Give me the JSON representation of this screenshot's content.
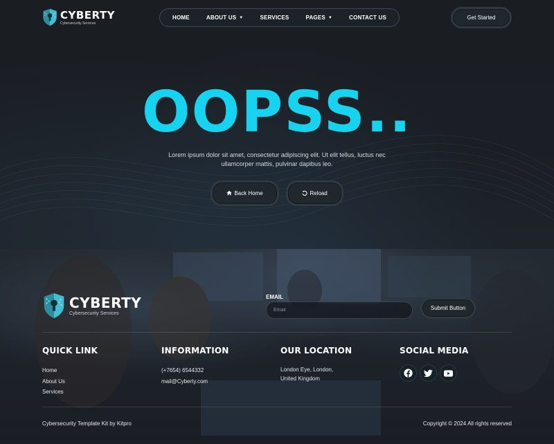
{
  "brand": {
    "name": "CYBERTY",
    "tagline": "Cybersecurity Services",
    "accent_color": "#16d4f0",
    "shield_color": "#3aa7b8"
  },
  "nav": {
    "items": [
      {
        "label": "HOME",
        "has_dropdown": false
      },
      {
        "label": "ABOUT US",
        "has_dropdown": true
      },
      {
        "label": "SERVICES",
        "has_dropdown": false
      },
      {
        "label": "PAGES",
        "has_dropdown": true
      },
      {
        "label": "CONTACT US",
        "has_dropdown": false
      }
    ],
    "dropdown_icon": "chevron-down-icon",
    "cta_label": "Get Started"
  },
  "hero": {
    "title": "OOPSS..",
    "text": "Lorem ipsum dolor sit amet, consectetur adipiscing elit. Ut elit tellus, luctus nec ullamcorper mattis, pulvinar dapibus leo.",
    "back_home": {
      "label": "Back Home",
      "icon": "home-icon"
    },
    "reload": {
      "label": "Reload",
      "icon": "reload-icon"
    }
  },
  "footer": {
    "newsletter": {
      "label": "EMAIL",
      "placeholder": "Email",
      "submit_label": "Submit Button"
    },
    "quick_link": {
      "title": "QUICK LINK",
      "links": [
        "Home",
        "About Us",
        "Services"
      ]
    },
    "information": {
      "title": "INFORMATION",
      "phone": "(+7654) 6544332",
      "email": "mail@Cyberty.com"
    },
    "location": {
      "title": "OUR LOCATION",
      "line1": "London Eye, London,",
      "line2": "United Kingdom"
    },
    "social": {
      "title": "SOCIAL MEDIA",
      "icons": [
        "facebook-icon",
        "twitter-icon",
        "youtube-icon"
      ]
    },
    "credit": "Cybersecurity Template Kit by Kitpro",
    "copyright": "Copyright © 2024 All rights reserved"
  }
}
